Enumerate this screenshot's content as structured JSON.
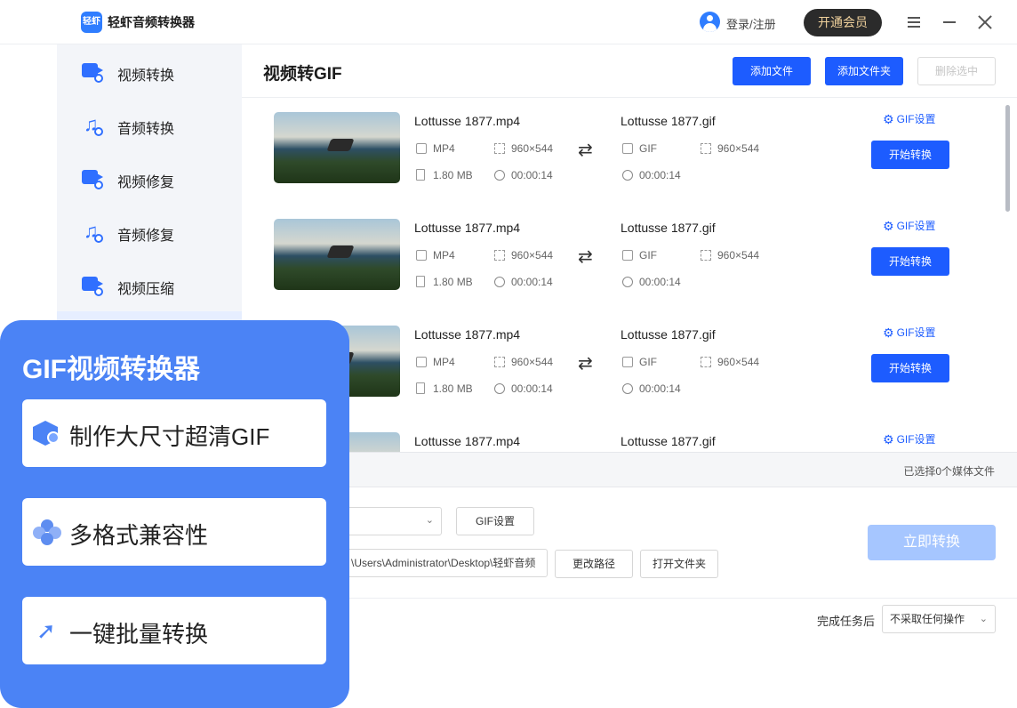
{
  "app": {
    "logo_text": "轻虾",
    "title": "轻虾音频转换器"
  },
  "titlebar": {
    "login_label": "登录/注册",
    "vip_label": "开通会员"
  },
  "sidebar": {
    "items": [
      {
        "label": "视频转换",
        "icon": "video-convert-icon"
      },
      {
        "label": "音频转换",
        "icon": "audio-convert-icon"
      },
      {
        "label": "视频修复",
        "icon": "video-repair-icon"
      },
      {
        "label": "音频修复",
        "icon": "audio-repair-icon"
      },
      {
        "label": "视频压缩",
        "icon": "video-compress-icon"
      }
    ]
  },
  "main": {
    "title": "视频转GIF",
    "add_file_label": "添加文件",
    "add_folder_label": "添加文件夹",
    "delete_selected_label": "删除选中"
  },
  "files": [
    {
      "source_name": "Lottusse 1877.mp4",
      "source_format": "MP4",
      "source_resolution": "960×544",
      "source_size": "1.80 MB",
      "source_duration": "00:00:14",
      "target_name": "Lottusse 1877.gif",
      "target_format": "GIF",
      "target_resolution": "960×544",
      "target_duration": "00:00:14",
      "settings_label": "GIF设置",
      "start_label": "开始转换"
    },
    {
      "source_name": "Lottusse 1877.mp4",
      "source_format": "MP4",
      "source_resolution": "960×544",
      "source_size": "1.80 MB",
      "source_duration": "00:00:14",
      "target_name": "Lottusse 1877.gif",
      "target_format": "GIF",
      "target_resolution": "960×544",
      "target_duration": "00:00:14",
      "settings_label": "GIF设置",
      "start_label": "开始转换"
    },
    {
      "source_name": "Lottusse 1877.mp4",
      "source_format": "MP4",
      "source_resolution": "960×544",
      "source_size": "1.80 MB",
      "source_duration": "00:00:14",
      "target_name": "Lottusse 1877.gif",
      "target_format": "GIF",
      "target_resolution": "960×544",
      "target_duration": "00:00:14",
      "settings_label": "GIF设置",
      "start_label": "开始转换"
    },
    {
      "source_name": "Lottusse 1877.mp4",
      "target_name": "Lottusse 1877.gif",
      "settings_label": "GIF设置"
    }
  ],
  "status": {
    "selected_text": "已选择0个媒体文件"
  },
  "output": {
    "gif_settings_label": "GIF设置",
    "path_value": "\\Users\\Administrator\\Desktop\\轻虾音频",
    "change_path_label": "更改路径",
    "open_folder_label": "打开文件夹",
    "convert_now_label": "立即转换"
  },
  "after_task": {
    "label": "完成任务后",
    "value": "不采取任何操作"
  },
  "promo": {
    "title": "GIF视频转换器",
    "features": [
      {
        "label": "制作大尺寸超清GIF",
        "icon": "hexagon-bolt-icon"
      },
      {
        "label": "多格式兼容性",
        "icon": "clover-icon"
      },
      {
        "label": "一键批量转换",
        "icon": "cursor-click-icon"
      }
    ]
  },
  "colors": {
    "accent": "#1d5cff",
    "promo_bg": "#4b83f5",
    "vip_text": "#f0d19c"
  }
}
